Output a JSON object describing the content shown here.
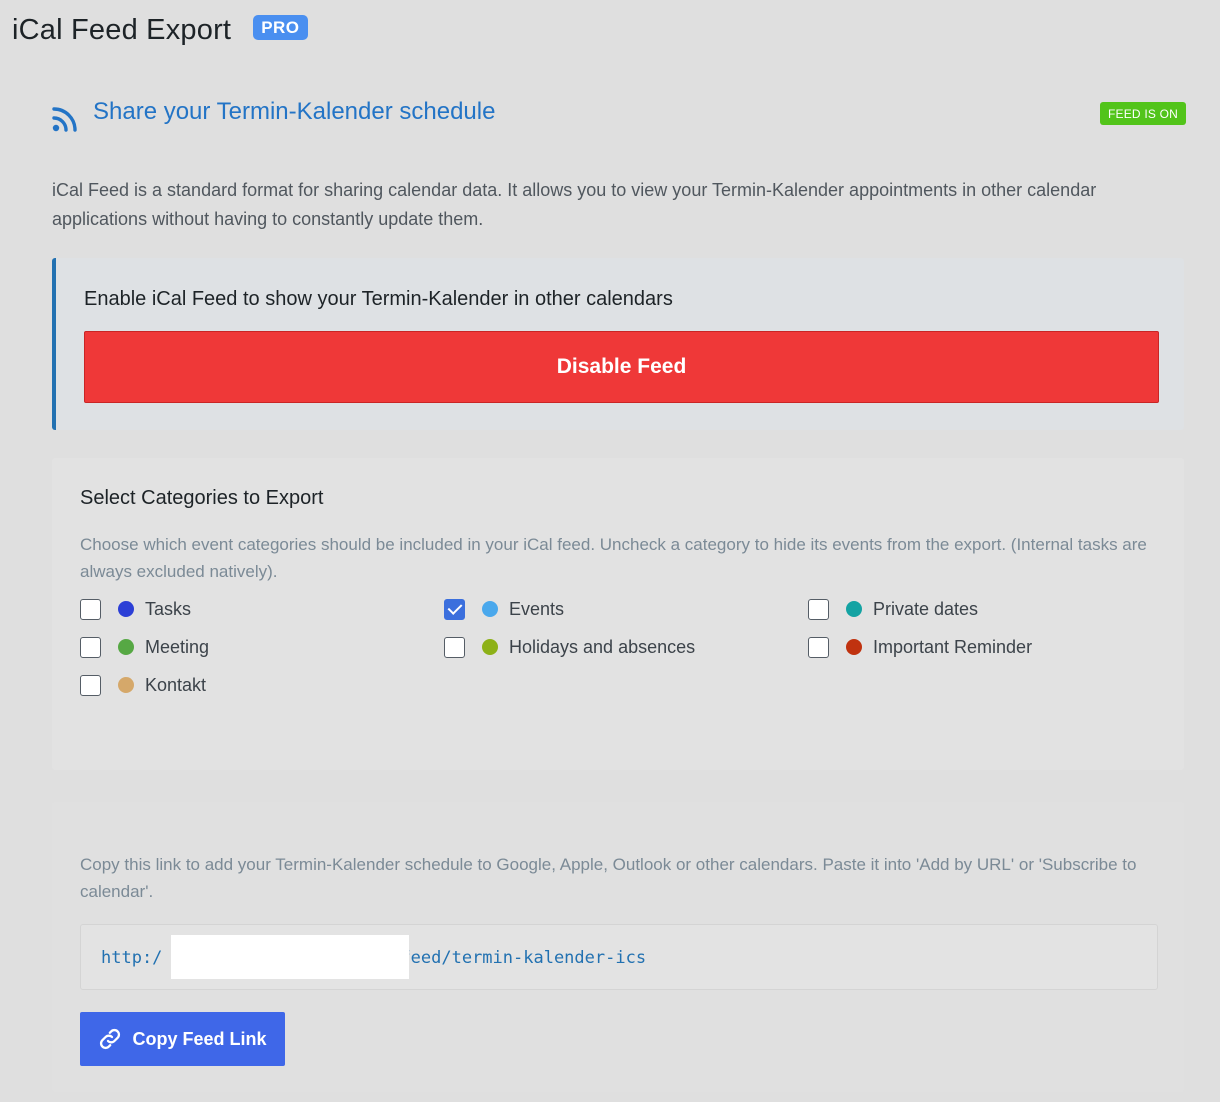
{
  "header": {
    "title": "iCal Feed Export",
    "badge": "PRO"
  },
  "section": {
    "title": "Share your Termin-Kalender schedule",
    "status_badge": "FEED IS ON",
    "icon": "rss-icon"
  },
  "intro": "iCal Feed is a standard format for sharing calendar data. It allows you to view your Termin-Kalender appointments in other calendar applications without having to constantly update them.",
  "enable_box": {
    "title": "Enable iCal Feed to show your Termin-Kalender in other calendars",
    "button_label": "Disable Feed"
  },
  "categories": {
    "title": "Select Categories to Export",
    "description": "Choose which event categories should be included in your iCal feed. Uncheck a category to hide its events from the export. (Internal tasks are always excluded natively).",
    "items": [
      {
        "label": "Tasks",
        "checked": false,
        "color": "#2c3fd6"
      },
      {
        "label": "Events",
        "checked": true,
        "color": "#4aa8ec"
      },
      {
        "label": "Private dates",
        "checked": false,
        "color": "#14a3a3"
      },
      {
        "label": "Meeting",
        "checked": false,
        "color": "#56a844"
      },
      {
        "label": "Holidays and absences",
        "checked": false,
        "color": "#8db118"
      },
      {
        "label": "Important Reminder",
        "checked": false,
        "color": "#c0320f"
      },
      {
        "label": "Kontakt",
        "checked": false,
        "color": "#d5a86a"
      }
    ]
  },
  "feed_link": {
    "description": "Copy this link to add your Termin-Kalender schedule to Google, Apple, Outlook or other calendars. Paste it into 'Add by URL' or 'Subscribe to calendar'.",
    "url_prefix": "http:/",
    "url_suffix": "feed/termin-kalender-ics",
    "copy_button_label": "Copy Feed Link",
    "copy_icon": "link-icon"
  },
  "colors": {
    "accent_blue": "#2374c6",
    "danger_red": "#ef3838",
    "success_green": "#52c41a",
    "primary_button": "#3f67e8",
    "pro_badge": "#4a8ff0"
  }
}
